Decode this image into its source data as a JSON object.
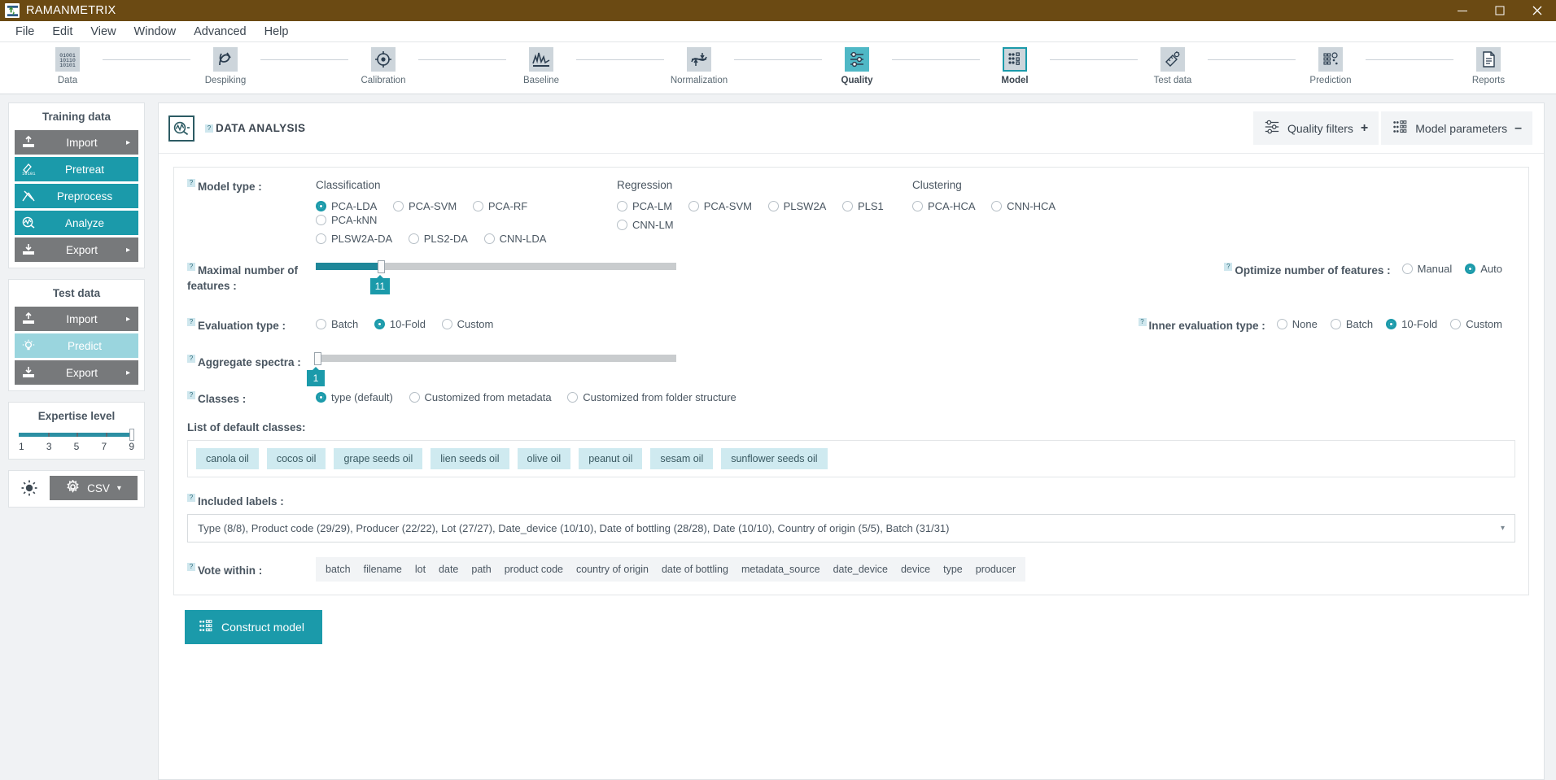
{
  "titlebar": {
    "app_title": "RAMANMETRIX",
    "logo_icon": "app-logo-icon",
    "minimize": "minimize-icon",
    "maximize": "maximize-icon",
    "close": "close-icon"
  },
  "menubar": {
    "items": [
      "File",
      "Edit",
      "View",
      "Window",
      "Advanced",
      "Help"
    ]
  },
  "steps": [
    {
      "label": "Data",
      "icon": "binary-data-icon",
      "state": "normal"
    },
    {
      "label": "Despiking",
      "icon": "despiking-icon",
      "state": "normal"
    },
    {
      "label": "Calibration",
      "icon": "calibration-target-icon",
      "state": "normal"
    },
    {
      "label": "Baseline",
      "icon": "baseline-spectrum-icon",
      "state": "normal"
    },
    {
      "label": "Normalization",
      "icon": "normalization-wave-icon",
      "state": "normal"
    },
    {
      "label": "Quality",
      "icon": "quality-sliders-icon",
      "state": "highlight"
    },
    {
      "label": "Model",
      "icon": "model-grid-icon",
      "state": "active"
    },
    {
      "label": "Test data",
      "icon": "test-data-icon",
      "state": "normal"
    },
    {
      "label": "Prediction",
      "icon": "prediction-icon",
      "state": "normal"
    },
    {
      "label": "Reports",
      "icon": "report-document-icon",
      "state": "normal"
    }
  ],
  "sidebar": {
    "training": {
      "title": "Training data",
      "buttons": [
        {
          "label": "Import",
          "arrow": "▸",
          "style": "grey",
          "icon": "upload-icon"
        },
        {
          "label": "Pretreat",
          "arrow": "",
          "style": "teal",
          "icon": "pretreat-icon"
        },
        {
          "label": "Preprocess",
          "arrow": "",
          "style": "teal",
          "icon": "preprocess-icon"
        },
        {
          "label": "Analyze",
          "arrow": "",
          "style": "teal",
          "icon": "analyze-icon"
        },
        {
          "label": "Export",
          "arrow": "▸",
          "style": "grey",
          "icon": "download-icon"
        }
      ]
    },
    "test": {
      "title": "Test data",
      "buttons": [
        {
          "label": "Import",
          "arrow": "▸",
          "style": "grey",
          "icon": "upload-icon"
        },
        {
          "label": "Predict",
          "arrow": "",
          "style": "teal-light",
          "icon": "bulb-icon"
        },
        {
          "label": "Export",
          "arrow": "▸",
          "style": "grey",
          "icon": "download-icon"
        }
      ]
    },
    "expertise": {
      "title": "Expertise level",
      "ticks": [
        "1",
        "3",
        "5",
        "7",
        "9"
      ],
      "value": 9,
      "min": 1,
      "max": 9
    },
    "tools": {
      "theme_icon": "sun-icon",
      "settings_icon": "gear-icon",
      "format_label": "CSV",
      "format_caret": "▾"
    }
  },
  "header": {
    "icon": "analysis-icon",
    "help_marker": "?",
    "title": "DATA ANALYSIS",
    "quality_filters": {
      "label": "Quality filters",
      "sign": "+",
      "icon": "sliders-icon"
    },
    "model_parameters": {
      "label": "Model parameters",
      "sign": "–",
      "icon": "model-grid-icon"
    }
  },
  "form": {
    "model_type": {
      "label": "Model type :",
      "columns": [
        {
          "heading": "Classification",
          "rows": [
            [
              {
                "label": "PCA-LDA",
                "selected": true
              },
              {
                "label": "PCA-SVM",
                "selected": false
              },
              {
                "label": "PCA-RF",
                "selected": false
              },
              {
                "label": "PCA-kNN",
                "selected": false
              }
            ],
            [
              {
                "label": "PLSW2A-DA",
                "selected": false
              },
              {
                "label": "PLS2-DA",
                "selected": false
              },
              {
                "label": "CNN-LDA",
                "selected": false
              }
            ]
          ]
        },
        {
          "heading": "Regression",
          "rows": [
            [
              {
                "label": "PCA-LM",
                "selected": false
              },
              {
                "label": "PCA-SVM",
                "selected": false
              },
              {
                "label": "PLSW2A",
                "selected": false
              },
              {
                "label": "PLS1",
                "selected": false
              }
            ],
            [
              {
                "label": "CNN-LM",
                "selected": false
              }
            ]
          ]
        },
        {
          "heading": "Clustering",
          "rows": [
            [
              {
                "label": "PCA-HCA",
                "selected": false
              },
              {
                "label": "CNN-HCA",
                "selected": false
              }
            ]
          ]
        }
      ]
    },
    "max_features": {
      "label_line1": "Maximal number of",
      "label_line2": "features :",
      "value": "11",
      "fill_percent": 18
    },
    "optimize_features": {
      "label": "Optimize number of features :",
      "options": [
        {
          "label": "Manual",
          "selected": false
        },
        {
          "label": "Auto",
          "selected": true
        }
      ]
    },
    "evaluation_type": {
      "label": "Evaluation type :",
      "options": [
        {
          "label": "Batch",
          "selected": false
        },
        {
          "label": "10-Fold",
          "selected": true
        },
        {
          "label": "Custom",
          "selected": false
        }
      ]
    },
    "inner_evaluation_type": {
      "label": "Inner evaluation type :",
      "options": [
        {
          "label": "None",
          "selected": false
        },
        {
          "label": "Batch",
          "selected": false
        },
        {
          "label": "10-Fold",
          "selected": true
        },
        {
          "label": "Custom",
          "selected": false
        }
      ]
    },
    "aggregate_spectra": {
      "label": "Aggregate spectra :",
      "value": "1",
      "fill_percent": 0
    },
    "classes": {
      "label": "Classes :",
      "options": [
        {
          "label": "type (default)",
          "selected": true
        },
        {
          "label": "Customized from metadata",
          "selected": false
        },
        {
          "label": "Customized from folder structure",
          "selected": false
        }
      ]
    },
    "default_classes": {
      "heading": "List of default classes:",
      "items": [
        "canola oil",
        "cocos oil",
        "grape seeds oil",
        "lien seeds oil",
        "olive oil",
        "peanut oil",
        "sesam oil",
        "sunflower seeds oil"
      ]
    },
    "included_labels": {
      "label": "Included labels :",
      "value": "Type (8/8), Product code (29/29), Producer (22/22), Lot (27/27), Date_device (10/10), Date of bottling (28/28), Date (10/10), Country of origin (5/5), Batch (31/31)",
      "caret": "▾"
    },
    "vote_within": {
      "label": "Vote within :",
      "tags": [
        "batch",
        "filename",
        "lot",
        "date",
        "path",
        "product code",
        "country of origin",
        "date of bottling",
        "metadata_source",
        "date_device",
        "device",
        "type",
        "producer"
      ]
    },
    "construct_button": {
      "label": "Construct model",
      "icon": "model-grid-icon"
    }
  },
  "colors": {
    "titlebar": "#6b4a13",
    "teal": "#1b9aaa",
    "teal_light": "#9ad5de",
    "grey_button": "#77797b",
    "chip": "#cfeaf0"
  }
}
